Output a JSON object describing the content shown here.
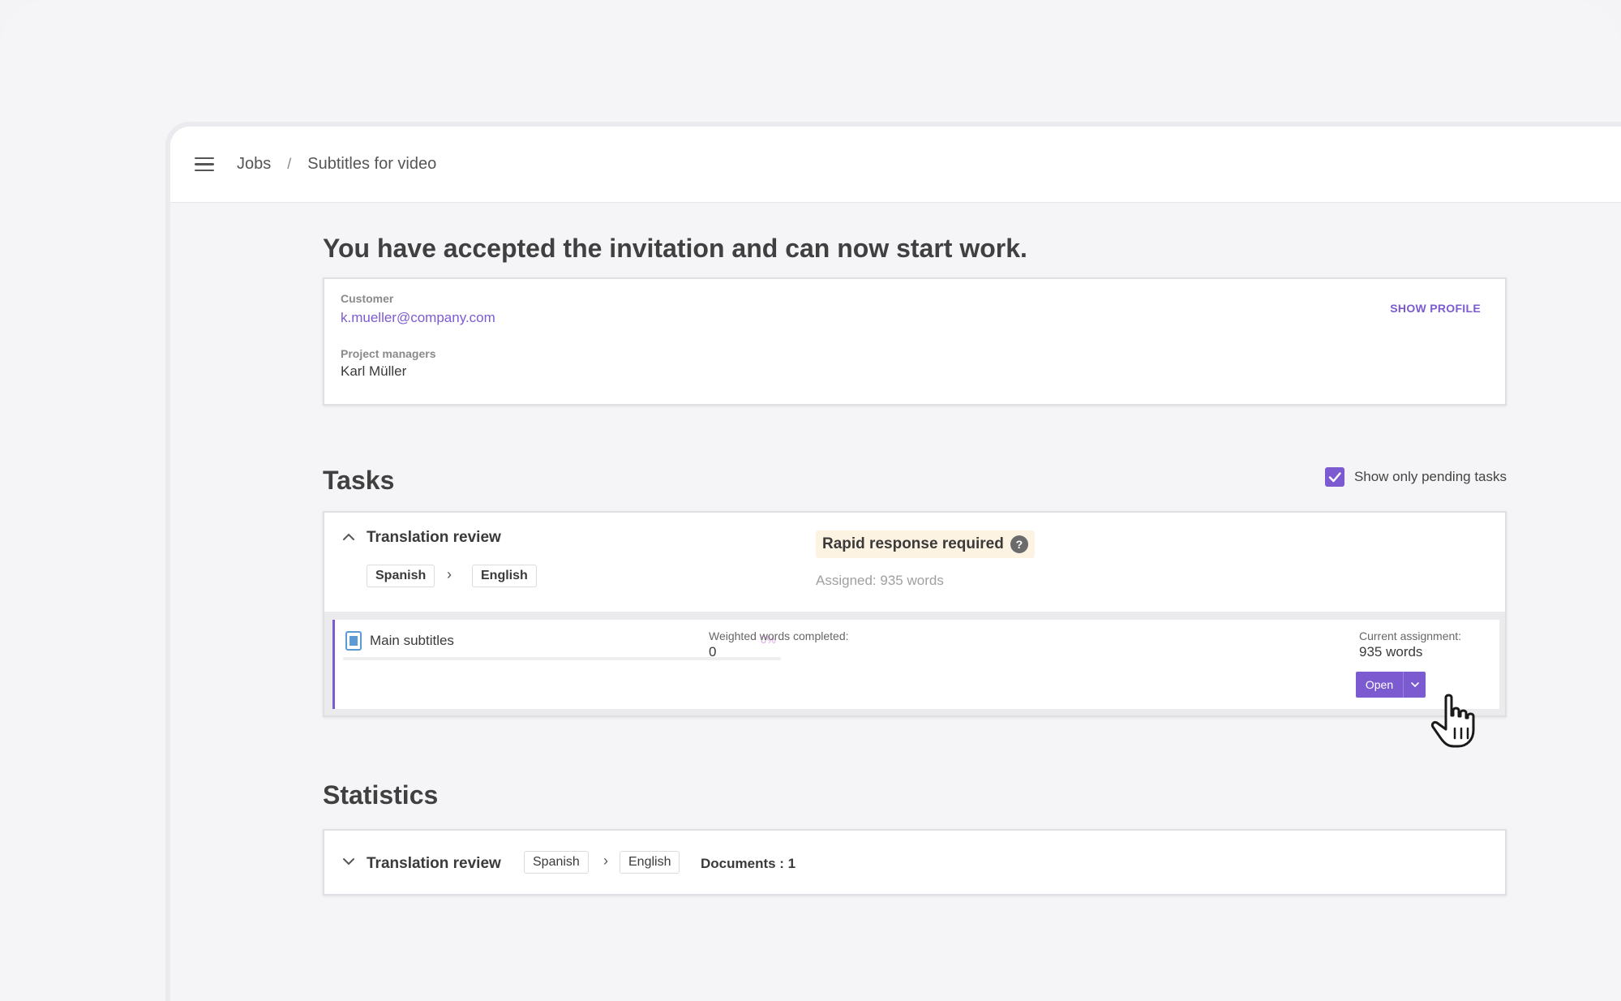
{
  "breadcrumb": {
    "jobs": "Jobs",
    "separator": "/",
    "current": "Subtitles for video"
  },
  "heading": "You have accepted the invitation and can now start work.",
  "customer_card": {
    "customer_label": "Customer",
    "customer_email": "k.mueller@company.com",
    "pm_label": "Project managers",
    "pm_name": "Karl Müller",
    "show_profile": "SHOW PROFILE"
  },
  "tasks": {
    "title": "Tasks",
    "pending_toggle_label": "Show only pending tasks",
    "pending_checked": true,
    "task": {
      "name": "Translation review",
      "source_lang": "Spanish",
      "target_lang": "English",
      "arrow": "›",
      "rapid_badge": "Rapid response required",
      "help_icon": "?",
      "assigned": "Assigned: 935 words"
    },
    "document": {
      "name": "Main subtitles",
      "percent": "0%",
      "progress": 0,
      "weighted_label": "Weighted words completed:",
      "weighted_value": "0",
      "assignment_label": "Current assignment:",
      "assignment_value": "935 words",
      "open_label": "Open"
    }
  },
  "statistics": {
    "title": "Statistics",
    "task_name": "Translation review",
    "source_lang": "Spanish",
    "target_lang": "English",
    "arrow": "›",
    "documents": "Documents : 1"
  },
  "colors": {
    "accent": "#7c5bd1",
    "badge_bg": "#fdf3e3"
  }
}
